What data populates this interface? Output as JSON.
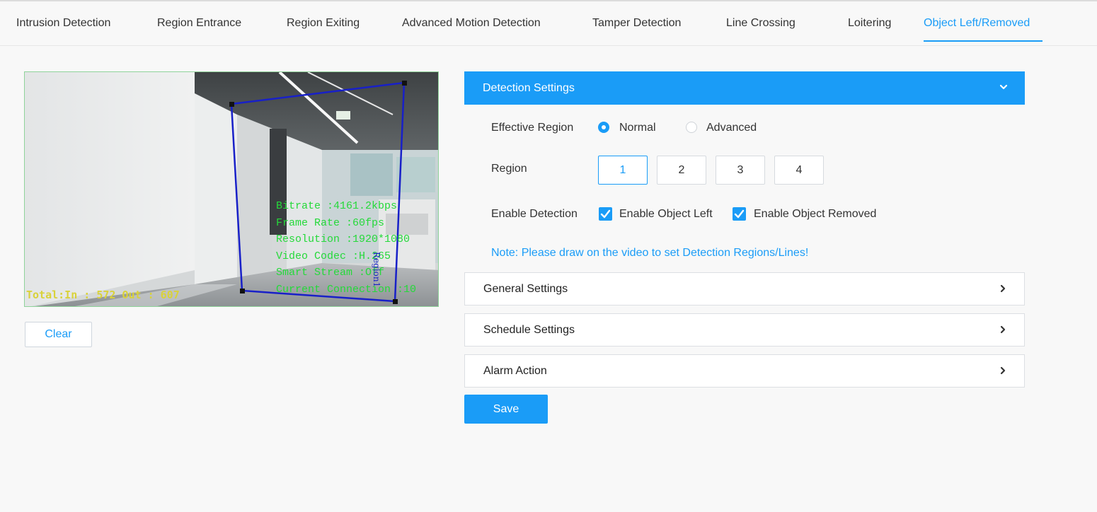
{
  "tabs": [
    {
      "label": "Intrusion Detection",
      "active": false
    },
    {
      "label": "Region Entrance",
      "active": false
    },
    {
      "label": "Region Exiting",
      "active": false
    },
    {
      "label": "Advanced Motion Detection",
      "active": false
    },
    {
      "label": "Tamper Detection",
      "active": false
    },
    {
      "label": "Line Crossing",
      "active": false
    },
    {
      "label": "Loitering",
      "active": false
    },
    {
      "label": "Object Left/Removed",
      "active": true
    }
  ],
  "video": {
    "osd_lines": [
      "Bitrate :4161.2kbps",
      "Frame Rate :60fps",
      "Resolution :1920*1080",
      "Video Codec :H.265",
      "Smart Stream :Off",
      "Current Connection :10"
    ],
    "counter": "Total:In : 572  Out : 607",
    "region_label": "Region1"
  },
  "clear_label": "Clear",
  "detection": {
    "title": "Detection Settings",
    "effective_region_label": "Effective Region",
    "normal_label": "Normal",
    "advanced_label": "Advanced",
    "selected_mode": "Normal",
    "region_label": "Region",
    "regions": [
      "1",
      "2",
      "3",
      "4"
    ],
    "selected_region": "1",
    "enable_detection_label": "Enable Detection",
    "enable_left_label": "Enable Object Left",
    "enable_removed_label": "Enable Object Removed",
    "note": "Note: Please draw on the video to set Detection Regions/Lines!"
  },
  "panels": {
    "general": "General Settings",
    "schedule": "Schedule Settings",
    "alarm": "Alarm Action"
  },
  "save_label": "Save",
  "colors": {
    "accent": "#1a9cf7",
    "osd_text": "#25d93a",
    "region_polygon": "#1820c8"
  }
}
